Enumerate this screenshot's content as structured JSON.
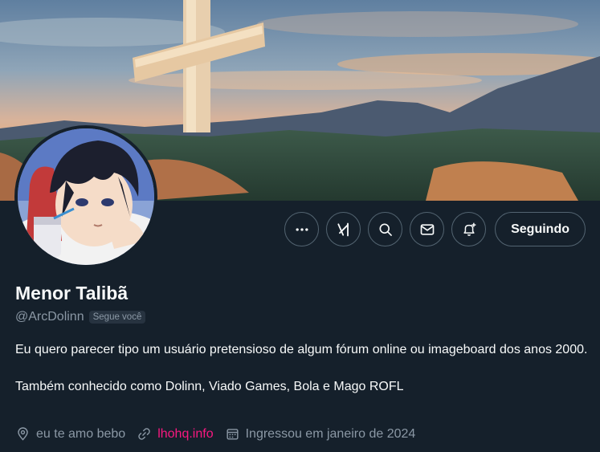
{
  "profile": {
    "display_name": "Menor Talibã",
    "handle": "@ArcDolinn",
    "follows_you_badge": "Segue você",
    "bio_line1": "Eu quero parecer tipo um usuário pretensioso de algum fórum online ou imageboard dos anos 2000.",
    "bio_line2": "Também conhecido como Dolinn, Viado Games, Bola e Mago ROFL",
    "location": "eu te amo bebo",
    "website": "lhohq.info",
    "joined": "Ingressou em janeiro de 2024"
  },
  "actions": {
    "more_icon": "more-icon",
    "grok_icon": "grok-icon",
    "search_icon": "search-icon",
    "message_icon": "mail-icon",
    "notify_icon": "bell-plus-icon",
    "follow_label": "Seguindo"
  },
  "colors": {
    "background": "#15202b",
    "text_primary": "#f7f9f9",
    "text_secondary": "#8b98a5",
    "border": "#536471",
    "link": "#f91880",
    "badge_bg": "#273340"
  }
}
